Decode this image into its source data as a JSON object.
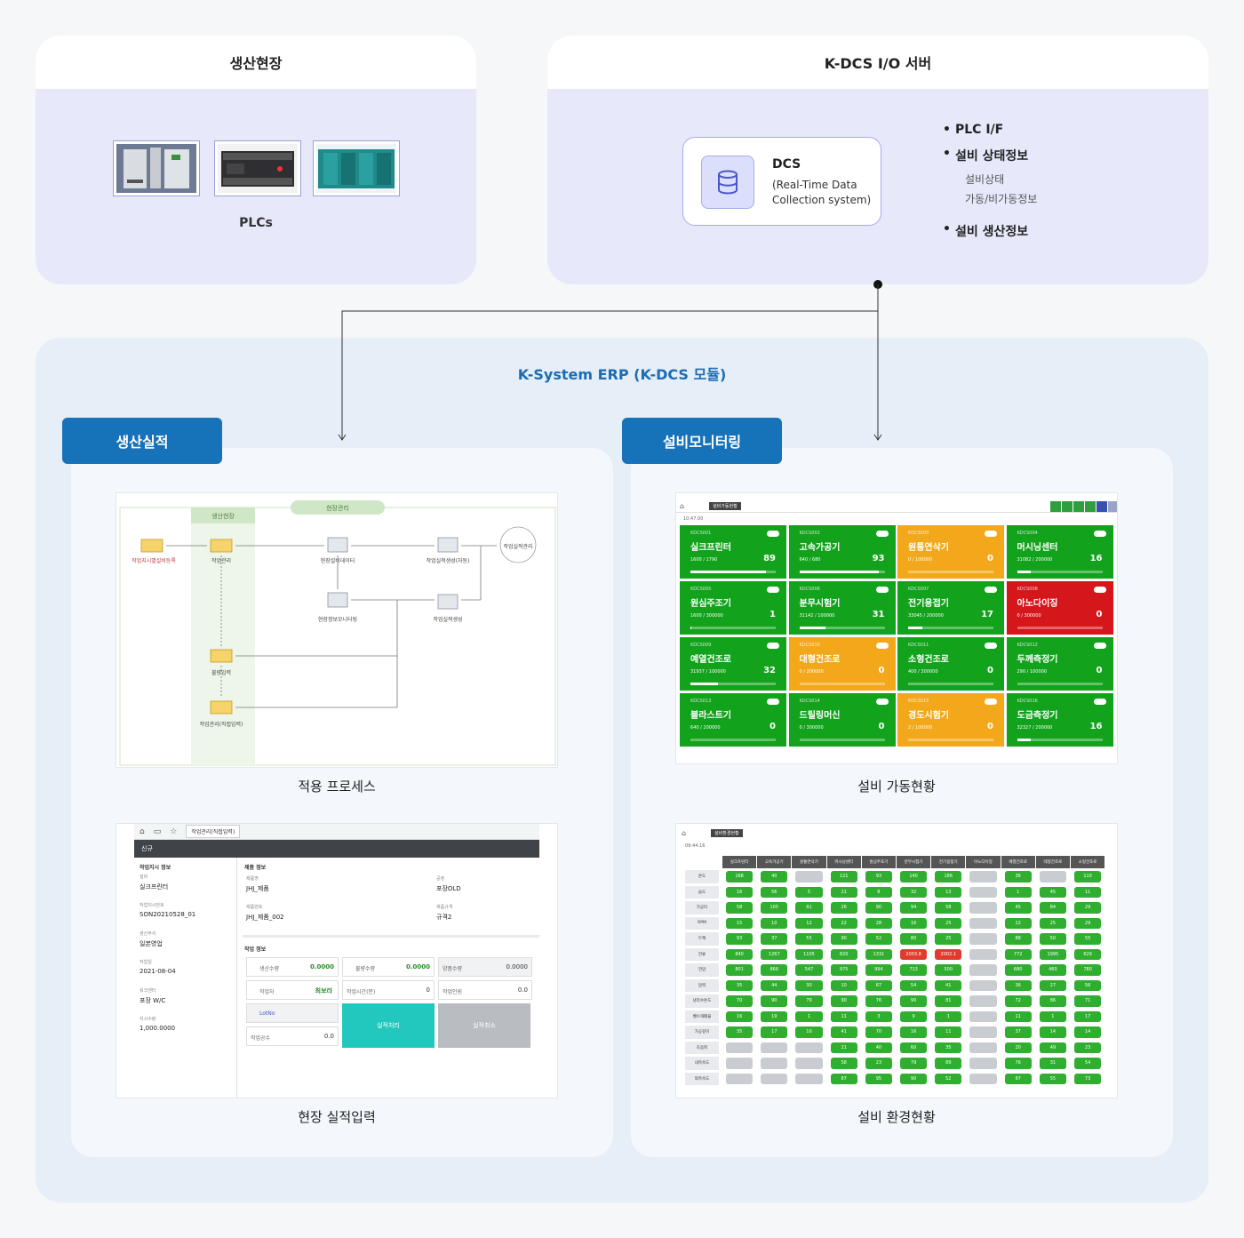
{
  "site": {
    "title": "생산현장",
    "plcs_label": "PLCs"
  },
  "server": {
    "title": "K-DCS I/O 서버",
    "dcs_title": "DCS",
    "dcs_sub_1": "(Real-Time Data",
    "dcs_sub_2": "Collection system)",
    "bullets": [
      "PLC I/F",
      "설비 상태정보",
      "설비 생산정보"
    ],
    "sub_bullets": [
      "설비상태",
      "가동/비가동정보"
    ]
  },
  "erp": {
    "title": "K-System ERP (K-DCS 모듈)",
    "left_tag": "생산실적",
    "right_tag": "설비모니터링",
    "captions": [
      "적용 프로세스",
      "현장 실적입력",
      "설비 가동현황",
      "설비 환경현황"
    ]
  },
  "process": {
    "header_site": "생산현장",
    "header_mgmt": "현장관리",
    "nodes": [
      "작업지시별설비등록",
      "작업관리",
      "현장설비데이터",
      "작업실적생성(자동)",
      "작업실적관리",
      "현장정보모니터링",
      "작업실적생성",
      "불량입력",
      "작업관리(직접입력)"
    ]
  },
  "monitor": {
    "tab": "설비가동현황",
    "time": "10:47:00",
    "tiles": [
      {
        "code": "KDCS001",
        "name": "실크프린터",
        "val": "1600 / 1790",
        "pct": "89",
        "status": "green"
      },
      {
        "code": "KDCS002",
        "name": "고속가공기",
        "val": "640 / 680",
        "pct": "93",
        "status": "green"
      },
      {
        "code": "KDCS003",
        "name": "원통연삭기",
        "val": "0 / 100000",
        "pct": "0",
        "status": "yellow"
      },
      {
        "code": "KDCS004",
        "name": "머시닝센터",
        "val": "31082 / 200000",
        "pct": "16",
        "status": "green"
      },
      {
        "code": "KDCS005",
        "name": "원심주조기",
        "val": "1600 / 300000",
        "pct": "1",
        "status": "green"
      },
      {
        "code": "KDCS006",
        "name": "분무시험기",
        "val": "31142 / 100000",
        "pct": "31",
        "status": "green"
      },
      {
        "code": "KDCS007",
        "name": "전기용접기",
        "val": "33045 / 200000",
        "pct": "17",
        "status": "green"
      },
      {
        "code": "KDCS008",
        "name": "아노다이징",
        "val": "0 / 300000",
        "pct": "0",
        "status": "red"
      },
      {
        "code": "KDCS009",
        "name": "예열건조로",
        "val": "31937 / 100000",
        "pct": "32",
        "status": "green"
      },
      {
        "code": "KDCS010",
        "name": "대형건조로",
        "val": "0 / 200000",
        "pct": "0",
        "status": "yellow"
      },
      {
        "code": "KDCS011",
        "name": "소형건조로",
        "val": "400 / 300000",
        "pct": "0",
        "status": "green"
      },
      {
        "code": "KDCS012",
        "name": "두께측정기",
        "val": "290 / 100000",
        "pct": "0",
        "status": "green"
      },
      {
        "code": "KDCS013",
        "name": "블라스트기",
        "val": "640 / 200000",
        "pct": "0",
        "status": "green"
      },
      {
        "code": "KDCS014",
        "name": "드릴링머신",
        "val": "0 / 300000",
        "pct": "0",
        "status": "green"
      },
      {
        "code": "KDCS015",
        "name": "경도시험기",
        "val": "2 / 100000",
        "pct": "0",
        "status": "yellow"
      },
      {
        "code": "KDCS016",
        "name": "도금측정기",
        "val": "32327 / 200000",
        "pct": "16",
        "status": "green"
      }
    ]
  },
  "input_form": {
    "tab": "작업관리(직접입력)",
    "new_label": "신규",
    "section_order": "작업지시 정보",
    "section_product": "제품 정보",
    "section_work": "작업 정보",
    "fields_left": [
      {
        "label": "설비",
        "value": "실크프린터"
      },
      {
        "label": "작업지시번호",
        "value": "SON20210528_01"
      },
      {
        "label": "생산부서",
        "value": "일본영업"
      },
      {
        "label": "작업일",
        "value": "2021-08-04"
      },
      {
        "label": "워크센터",
        "value": "포장 W/C"
      },
      {
        "label": "지시수량",
        "value": "1,000.0000"
      }
    ],
    "product": [
      {
        "label": "제품명",
        "value": "JHJ_제품"
      },
      {
        "label": "공정",
        "value": "포장OLD"
      },
      {
        "label": "제품번호",
        "value": "JHJ_제품_002"
      },
      {
        "label": "제품규격",
        "value": "규격2"
      }
    ],
    "work": {
      "prod_qty_label": "생산수량",
      "prod_qty": "0.0000",
      "bad_qty_label": "불량수량",
      "bad_qty": "0.0000",
      "good_qty_label": "양품수량",
      "good_qty": "0.0000",
      "worker_label": "작업자",
      "worker": "최보라",
      "time_label": "작업시간(분)",
      "time": "0",
      "people_label": "작업인원",
      "people": "0.0",
      "lot_label": "LotNo",
      "workers_label": "작업공수",
      "workers": "0.0",
      "process_btn": "실적처리",
      "cancel_btn": "실적취소"
    }
  },
  "env": {
    "tab": "설비환경현황",
    "time": "09:44:16",
    "columns": [
      "실크프린터",
      "고속가공기",
      "원통연삭기",
      "머시닝센터",
      "원심주조기",
      "분무시험기",
      "전기용접기",
      "아노다이징",
      "예열건조로",
      "대형건조로",
      "소형건조로"
    ],
    "rows": [
      "온도",
      "습도",
      "가공타",
      "RPM",
      "두께",
      "전류",
      "전압",
      "압력",
      "냉각수온도",
      "벨브개폐율",
      "가공깊이",
      "초음파",
      "내측속도",
      "외측속도"
    ],
    "values": [
      [
        "168",
        "40",
        "",
        "121",
        "93",
        "140",
        "186",
        "",
        "36",
        "",
        "110"
      ],
      [
        "16",
        "56",
        "5",
        "21",
        "8",
        "32",
        "13",
        "",
        "1",
        "45",
        "11"
      ],
      [
        "58",
        "105",
        "91",
        "26",
        "90",
        "94",
        "58",
        "",
        "45",
        "84",
        "29"
      ],
      [
        "15",
        "10",
        "12",
        "22",
        "28",
        "16",
        "25",
        "",
        "22",
        "25",
        "29"
      ],
      [
        "93",
        "37",
        "55",
        "90",
        "52",
        "80",
        "25",
        "",
        "88",
        "50",
        "55"
      ],
      [
        "840",
        "1267",
        "1105",
        "820",
        "1331",
        "2003.8",
        "2002.1",
        "",
        "772",
        "1995",
        "629"
      ],
      [
        "801",
        "866",
        "547",
        "975",
        "994",
        "713",
        "500",
        "",
        "680",
        "460",
        "780"
      ],
      [
        "35",
        "44",
        "30",
        "10",
        "67",
        "54",
        "41",
        "",
        "36",
        "27",
        "56"
      ],
      [
        "70",
        "90",
        "79",
        "90",
        "76",
        "90",
        "81",
        "",
        "72",
        "86",
        "71"
      ],
      [
        "16",
        "19",
        "1",
        "11",
        "3",
        "9",
        "1",
        "",
        "11",
        "1",
        "17"
      ],
      [
        "35",
        "17",
        "10",
        "41",
        "70",
        "16",
        "11",
        "",
        "37",
        "14",
        "14"
      ],
      [
        "",
        "",
        "",
        "21",
        "40",
        "60",
        "35",
        "",
        "20",
        "49",
        "23"
      ],
      [
        "",
        "",
        "",
        "58",
        "23",
        "79",
        "89",
        "",
        "76",
        "31",
        "54"
      ],
      [
        "",
        "",
        "",
        "87",
        "95",
        "90",
        "52",
        "",
        "97",
        "55",
        "73"
      ]
    ],
    "alerts": [
      "5,5",
      "5,6"
    ]
  }
}
